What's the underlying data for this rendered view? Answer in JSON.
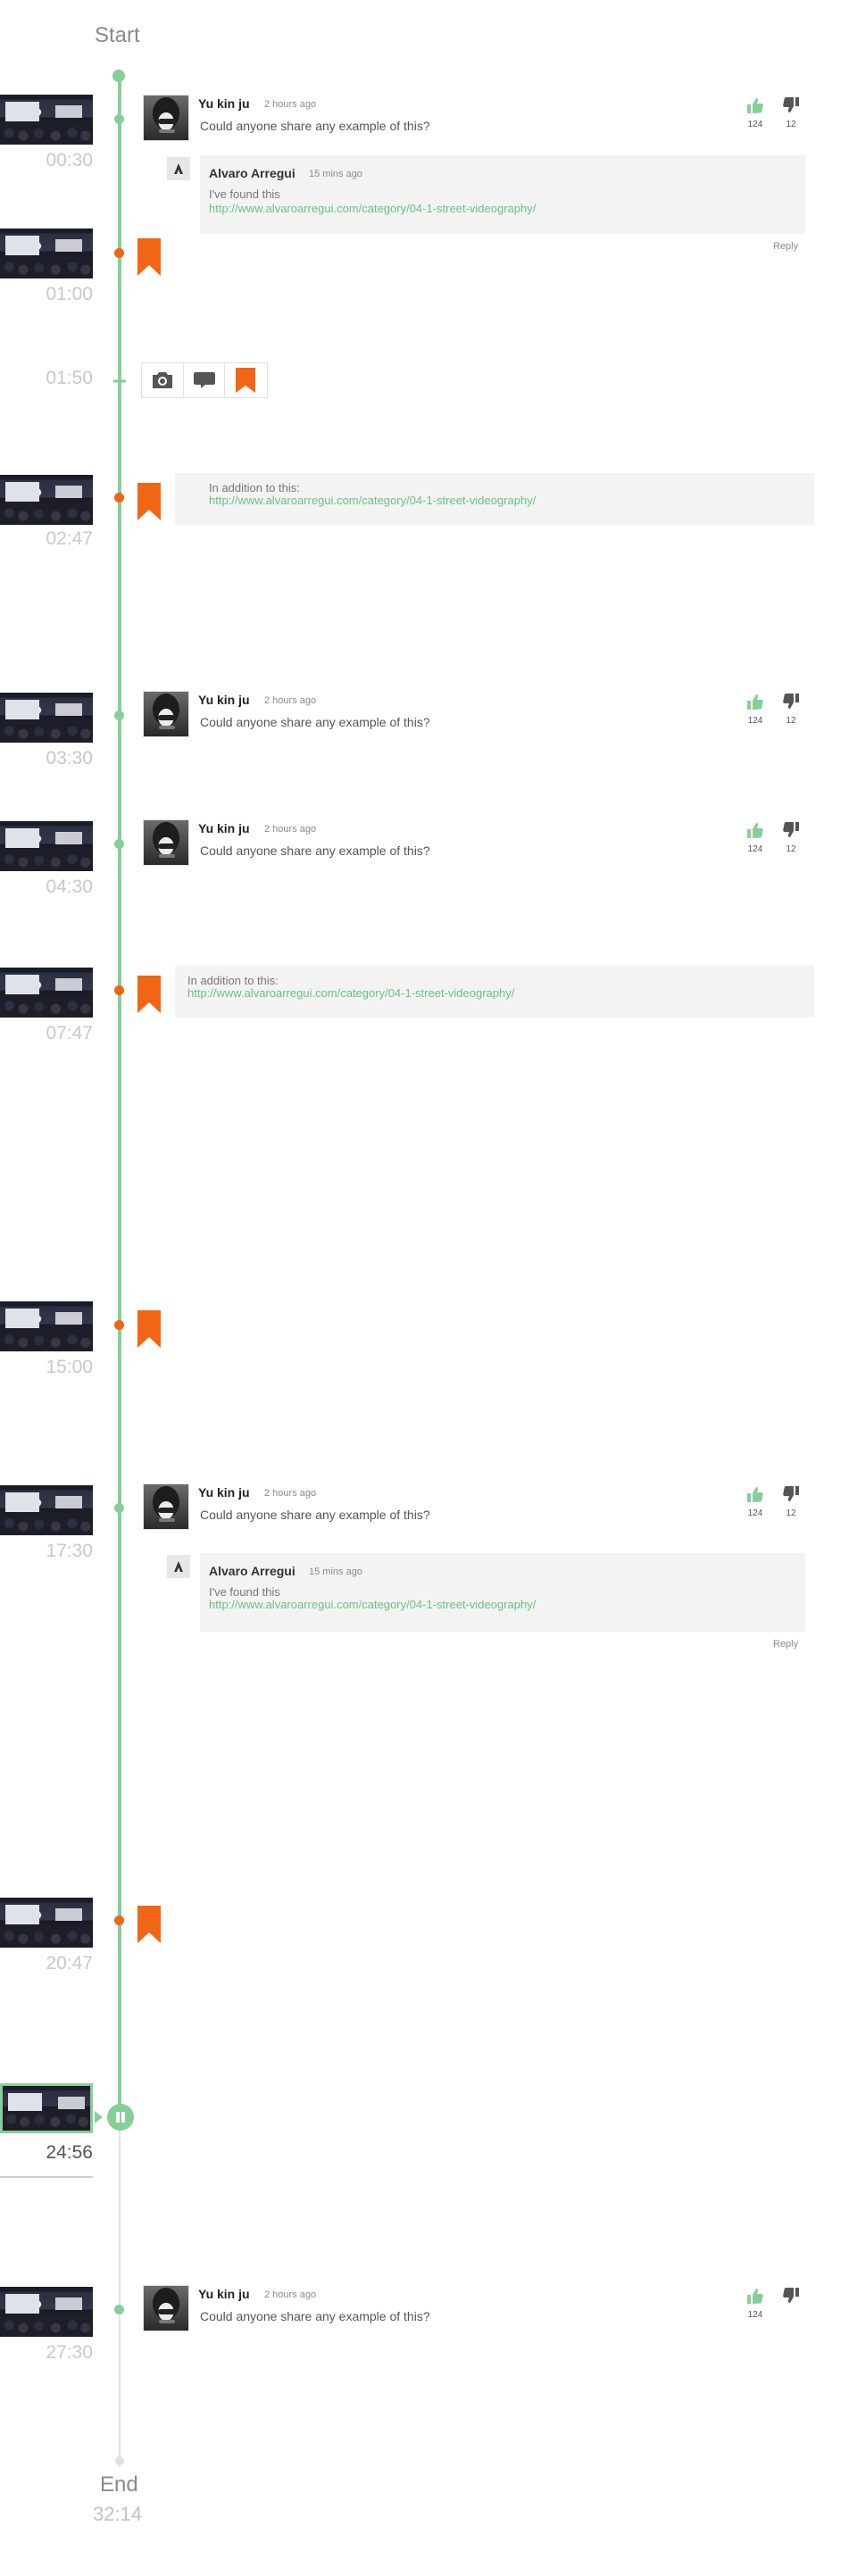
{
  "timeline": {
    "start_label": "Start",
    "end_label": "End",
    "end_time": "32:14",
    "add_time": "01:50",
    "now_time": "24:56"
  },
  "entries": [
    {
      "time": "00:30",
      "type": "comment"
    },
    {
      "time": "01:00",
      "type": "bookmark"
    },
    {
      "time": "02:47",
      "type": "note"
    },
    {
      "time": "03:30",
      "type": "comment"
    },
    {
      "time": "04:30",
      "type": "comment"
    },
    {
      "time": "07:47",
      "type": "note"
    },
    {
      "time": "15:00",
      "type": "bookmark"
    },
    {
      "time": "17:30",
      "type": "comment"
    },
    {
      "time": "20:47",
      "type": "bookmark"
    },
    {
      "time": "27:30",
      "type": "comment"
    }
  ],
  "comment": {
    "user": "Yu kin ju",
    "ago": "2 hours ago",
    "text": "Could anyone share any example of this?",
    "likes": "124",
    "dislikes": "12"
  },
  "reply": {
    "user": "Alvaro Arregui",
    "ago": "15 mins ago",
    "text": "I've found this",
    "link": "http://www.alvaroarregui.com/category/04-1-street-videography/",
    "reply_label": "Reply"
  },
  "note": {
    "text": "In addition to this:",
    "link": "http://www.alvaroarregui.com/category/04-1-street-videography/"
  },
  "colors": {
    "accent": "#86cf96",
    "bookmark": "#f16615",
    "dislike": "#555555"
  },
  "icons": [
    "camera-icon",
    "speech-bubble-icon",
    "bookmark-icon",
    "thumbs-up-icon",
    "thumbs-down-icon",
    "pause-icon",
    "plus-icon"
  ]
}
